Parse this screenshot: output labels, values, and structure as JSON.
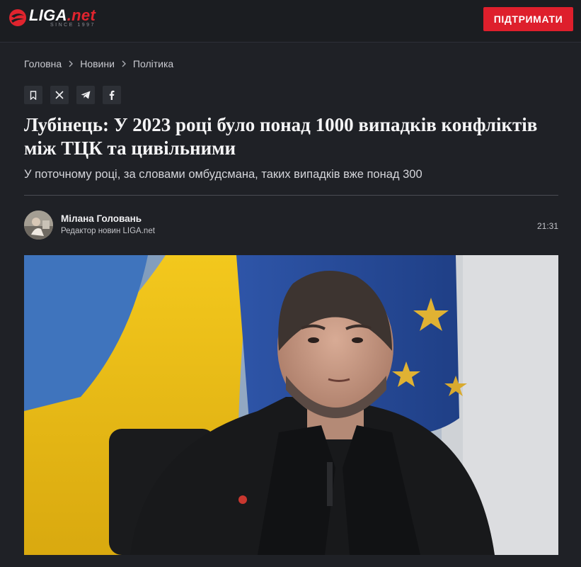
{
  "brand": {
    "logo_word": "LIGA",
    "logo_suffix": ".net",
    "since": "SINCE 1997"
  },
  "header": {
    "support_label": "ПІДТРИМАТИ"
  },
  "breadcrumb": [
    {
      "label": "Головна"
    },
    {
      "label": "Новини"
    },
    {
      "label": "Політика"
    }
  ],
  "share_icons": [
    "bookmark-icon",
    "x-icon",
    "telegram-icon",
    "facebook-icon"
  ],
  "article": {
    "title": "Лубінець: У 2023 році було понад 1000 випадків конфліктів між ТЦК та цивільними",
    "subtitle": "У поточному році, за словами омбудсмана, таких випадків вже понад 300",
    "time": "21:31"
  },
  "author": {
    "name": "Мілана Головань",
    "role": "Редактор новин LIGA.net"
  },
  "colors": {
    "background": "#1f2126",
    "accent": "#de1f2c",
    "text": "#f4f4f5"
  }
}
